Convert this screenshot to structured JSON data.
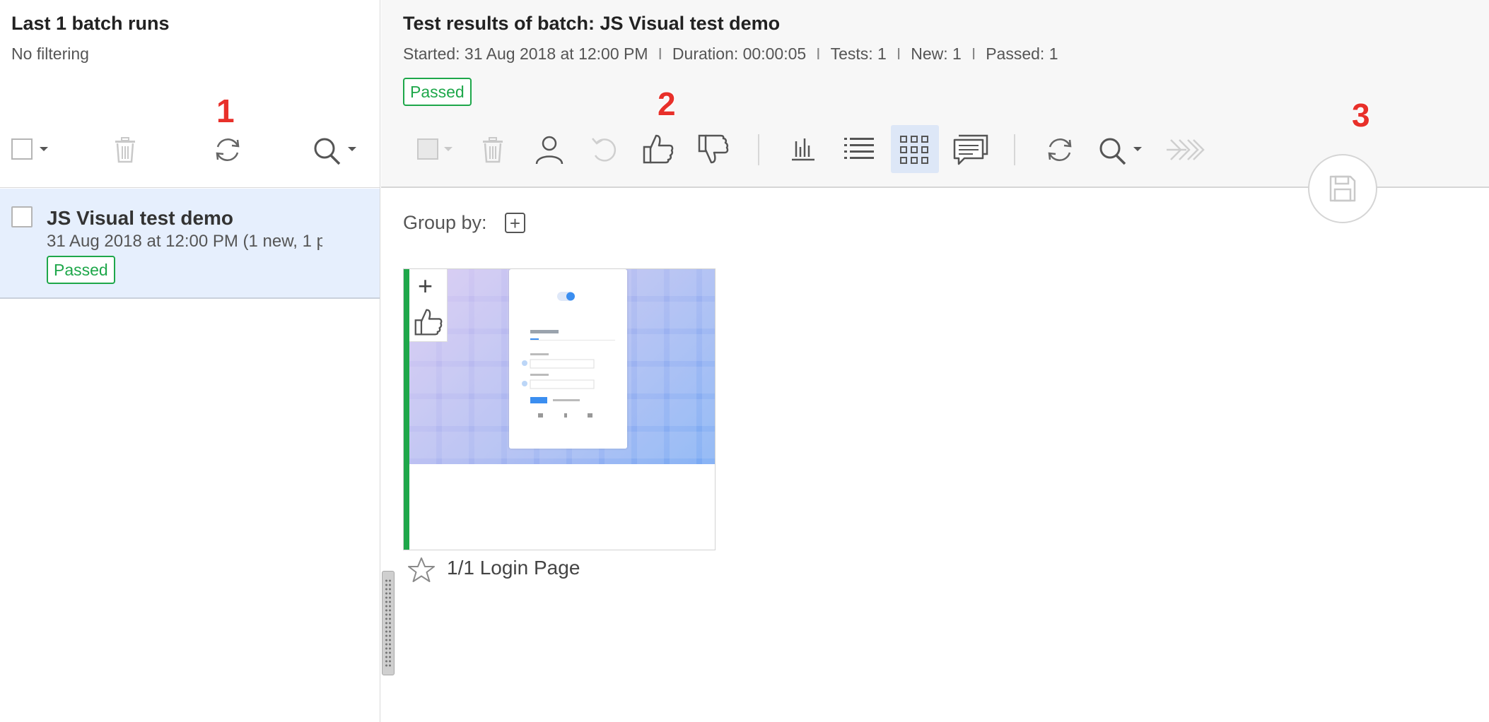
{
  "left_panel": {
    "title": "Last 1 batch runs",
    "filter_status": "No filtering",
    "annotation": "1",
    "run": {
      "name": "JS Visual test demo",
      "meta": "31 Aug 2018 at 12:00 PM  (1 new, 1 p",
      "status": "Passed"
    }
  },
  "right_panel": {
    "title": "Test results of batch: JS Visual test demo",
    "stats": {
      "started": "Started: 31 Aug 2018 at 12:00 PM",
      "duration": "Duration: 00:00:05",
      "tests": "Tests: 1",
      "new": "New: 1",
      "passed": "Passed: 1",
      "separator": "I"
    },
    "status": "Passed",
    "annotation_2": "2",
    "annotation_3": "3",
    "group_by_label": "Group by:",
    "group_add_symbol": "+",
    "tile": {
      "plus_symbol": "+",
      "caption": "1/1 Login Page",
      "status_color": "#1ea74a"
    }
  },
  "colors": {
    "passed": "#1ea74a",
    "annotation": "#e8302a",
    "selected_row": "#e6effd",
    "active_view": "#dde7f7"
  },
  "icons": [
    "checkbox-dropdown-icon",
    "trash-icon",
    "refresh-icon",
    "search-dropdown-icon",
    "user-icon",
    "undo-icon",
    "thumbs-up-icon",
    "thumbs-down-icon",
    "bar-chart-icon",
    "list-view-icon",
    "grid-view-icon",
    "comments-icon",
    "merge-arrows-icon",
    "save-icon",
    "star-icon"
  ]
}
